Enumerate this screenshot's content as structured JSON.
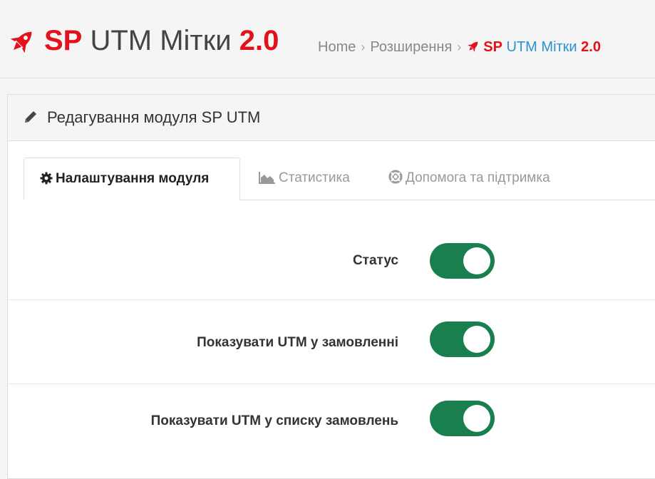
{
  "header": {
    "title_sp": "SP",
    "title_mid": " UTM Мітки ",
    "title_ver": "2.0",
    "breadcrumb": {
      "home": "Home",
      "extensions": "Розширення",
      "current_sp": "SP",
      "current_mid": " UTM Мітки ",
      "current_ver": "2.0"
    }
  },
  "panel": {
    "title": "Редагування модуля SP UTM"
  },
  "tabs": [
    {
      "label": "Налаштування модуля",
      "icon": "gear-icon",
      "active": true
    },
    {
      "label": "Статистика",
      "icon": "area-chart-icon",
      "active": false
    },
    {
      "label": "Допомога та підтримка",
      "icon": "life-ring-icon",
      "active": false
    }
  ],
  "settings": [
    {
      "label": "Статус",
      "enabled": true
    },
    {
      "label": "Показувати UTM у замовленні",
      "enabled": true
    },
    {
      "label": "Показувати UTM у списку замовлень",
      "enabled": true
    }
  ],
  "colors": {
    "brand_red": "#e4101b",
    "link_blue": "#2a93d0",
    "toggle_on": "#1a7f4e"
  }
}
